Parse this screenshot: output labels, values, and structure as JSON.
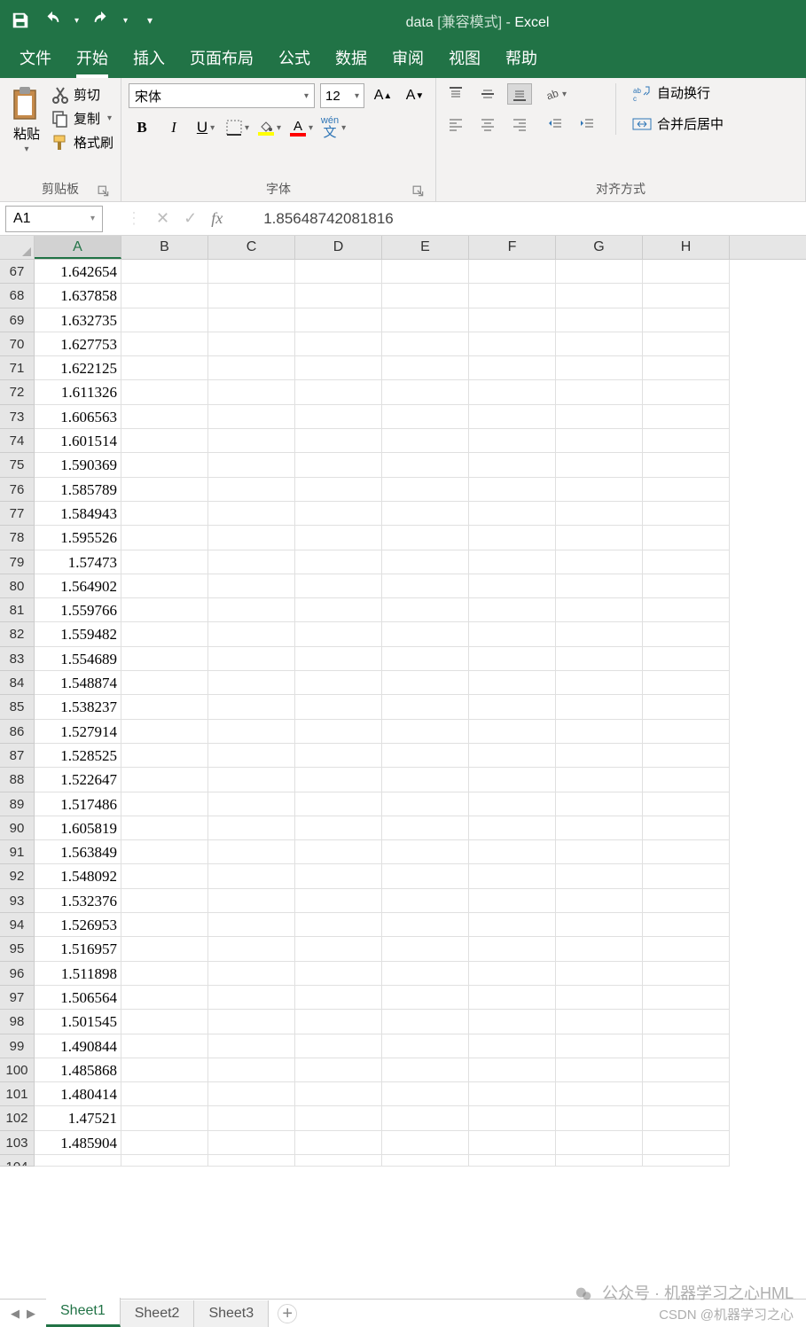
{
  "title": {
    "doc": "data",
    "mode": "[兼容模式]",
    "sep": " - ",
    "app": "Excel"
  },
  "menu": {
    "file": "文件",
    "home": "开始",
    "insert": "插入",
    "layout": "页面布局",
    "formula": "公式",
    "data": "数据",
    "review": "审阅",
    "view": "视图",
    "help": "帮助"
  },
  "ribbon": {
    "clipboard": {
      "paste": "粘贴",
      "cut": "剪切",
      "copy": "复制",
      "format_painter": "格式刷",
      "label": "剪贴板"
    },
    "font": {
      "name": "宋体",
      "size": "12",
      "label": "字体"
    },
    "align": {
      "wrap": "自动换行",
      "merge": "合并后居中",
      "label": "对齐方式"
    }
  },
  "formula_bar": {
    "cell_ref": "A1",
    "fx": "fx",
    "value": "1.85648742081816"
  },
  "columns": [
    "A",
    "B",
    "C",
    "D",
    "E",
    "F",
    "G",
    "H"
  ],
  "rows": [
    {
      "n": 67,
      "a": "1.642654"
    },
    {
      "n": 68,
      "a": "1.637858"
    },
    {
      "n": 69,
      "a": "1.632735"
    },
    {
      "n": 70,
      "a": "1.627753"
    },
    {
      "n": 71,
      "a": "1.622125"
    },
    {
      "n": 72,
      "a": "1.611326"
    },
    {
      "n": 73,
      "a": "1.606563"
    },
    {
      "n": 74,
      "a": "1.601514"
    },
    {
      "n": 75,
      "a": "1.590369"
    },
    {
      "n": 76,
      "a": "1.585789"
    },
    {
      "n": 77,
      "a": "1.584943"
    },
    {
      "n": 78,
      "a": "1.595526"
    },
    {
      "n": 79,
      "a": "1.57473"
    },
    {
      "n": 80,
      "a": "1.564902"
    },
    {
      "n": 81,
      "a": "1.559766"
    },
    {
      "n": 82,
      "a": "1.559482"
    },
    {
      "n": 83,
      "a": "1.554689"
    },
    {
      "n": 84,
      "a": "1.548874"
    },
    {
      "n": 85,
      "a": "1.538237"
    },
    {
      "n": 86,
      "a": "1.527914"
    },
    {
      "n": 87,
      "a": "1.528525"
    },
    {
      "n": 88,
      "a": "1.522647"
    },
    {
      "n": 89,
      "a": "1.517486"
    },
    {
      "n": 90,
      "a": "1.605819"
    },
    {
      "n": 91,
      "a": "1.563849"
    },
    {
      "n": 92,
      "a": "1.548092"
    },
    {
      "n": 93,
      "a": "1.532376"
    },
    {
      "n": 94,
      "a": "1.526953"
    },
    {
      "n": 95,
      "a": "1.516957"
    },
    {
      "n": 96,
      "a": "1.511898"
    },
    {
      "n": 97,
      "a": "1.506564"
    },
    {
      "n": 98,
      "a": "1.501545"
    },
    {
      "n": 99,
      "a": "1.490844"
    },
    {
      "n": 100,
      "a": "1.485868"
    },
    {
      "n": 101,
      "a": "1.480414"
    },
    {
      "n": 102,
      "a": "1.47521"
    },
    {
      "n": 103,
      "a": "1.485904"
    }
  ],
  "sheets": {
    "s1": "Sheet1",
    "s2": "Sheet2",
    "s3": "Sheet3"
  },
  "watermark": {
    "line1": "公众号 · 机器学习之心HML",
    "line2": "CSDN @机器学习之心"
  }
}
